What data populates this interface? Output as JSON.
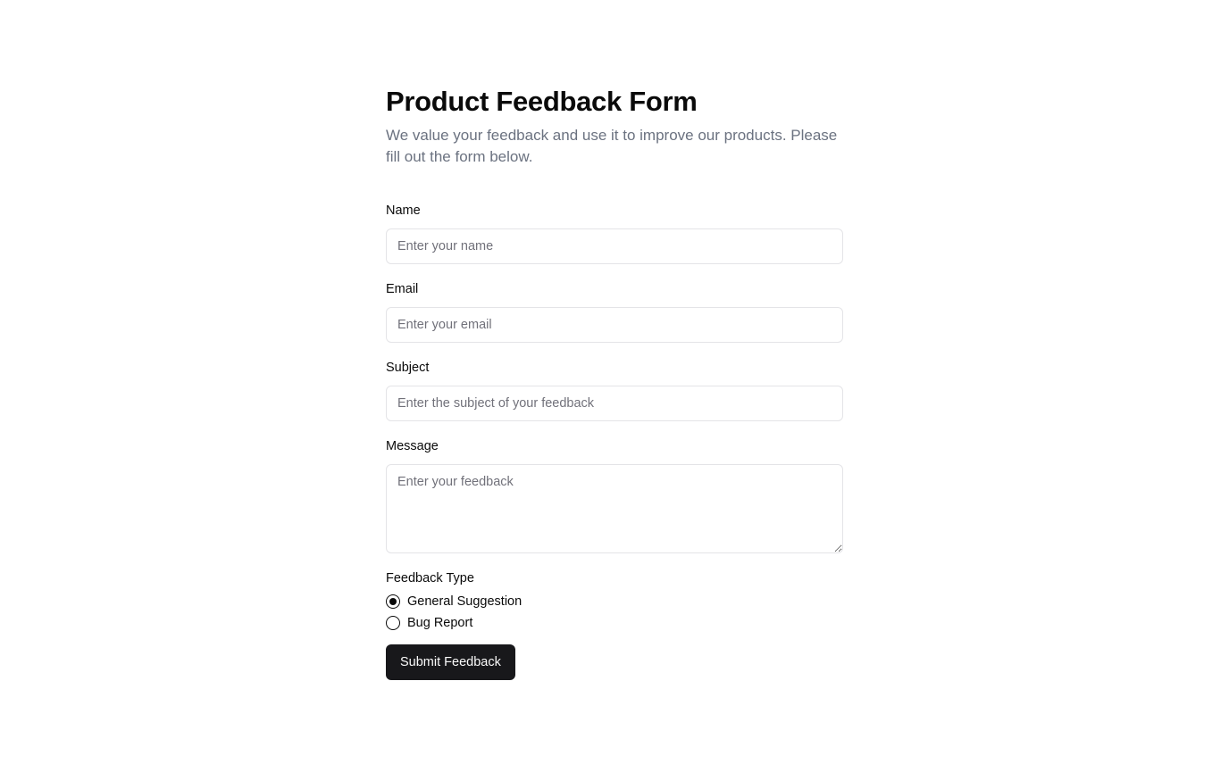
{
  "header": {
    "title": "Product Feedback Form",
    "subtitle": "We value your feedback and use it to improve our products. Please fill out the form below."
  },
  "fields": {
    "name": {
      "label": "Name",
      "placeholder": "Enter your name",
      "value": ""
    },
    "email": {
      "label": "Email",
      "placeholder": "Enter your email",
      "value": ""
    },
    "subject": {
      "label": "Subject",
      "placeholder": "Enter the subject of your feedback",
      "value": ""
    },
    "message": {
      "label": "Message",
      "placeholder": "Enter your feedback",
      "value": ""
    }
  },
  "feedback_type": {
    "label": "Feedback Type",
    "options": [
      {
        "label": "General Suggestion",
        "selected": true
      },
      {
        "label": "Bug Report",
        "selected": false
      }
    ]
  },
  "submit": {
    "label": "Submit Feedback"
  },
  "colors": {
    "primary_button": "#18181b",
    "muted_text": "#6b7280",
    "input_border": "#e4e4e7"
  }
}
